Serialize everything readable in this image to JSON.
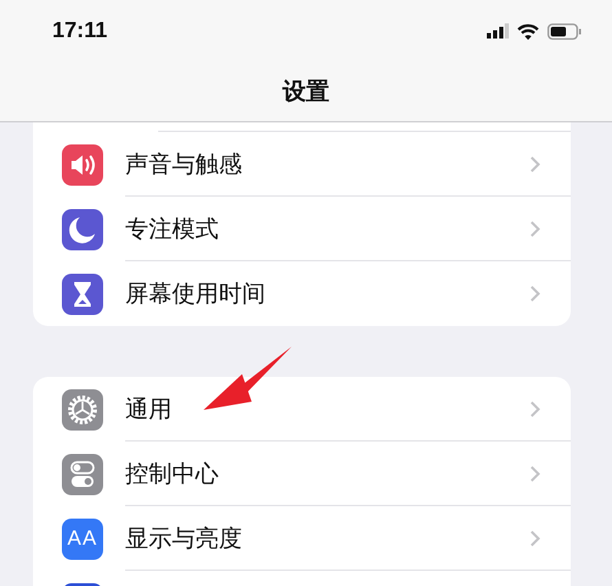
{
  "status_bar": {
    "time": "17:11"
  },
  "header": {
    "title": "设置"
  },
  "groups": [
    {
      "rows": [
        {
          "kind": "sound",
          "color": "#e8455b",
          "label": "声音与触感"
        },
        {
          "kind": "moon",
          "color": "#5b57d1",
          "label": "专注模式"
        },
        {
          "kind": "hourglass",
          "color": "#5b57d1",
          "label": "屏幕使用时间"
        }
      ]
    },
    {
      "rows": [
        {
          "kind": "gear",
          "color": "#8e8e93",
          "label": "通用"
        },
        {
          "kind": "toggles",
          "color": "#8e8e93",
          "label": "控制中心"
        },
        {
          "kind": "glyph",
          "glyph": "AA",
          "color": "#3478f6",
          "label": "显示与亮度"
        },
        {
          "kind": "blank",
          "color": "#2c4fd6"
        }
      ]
    }
  ],
  "annotations": [
    {
      "kind": "arrow"
    }
  ]
}
